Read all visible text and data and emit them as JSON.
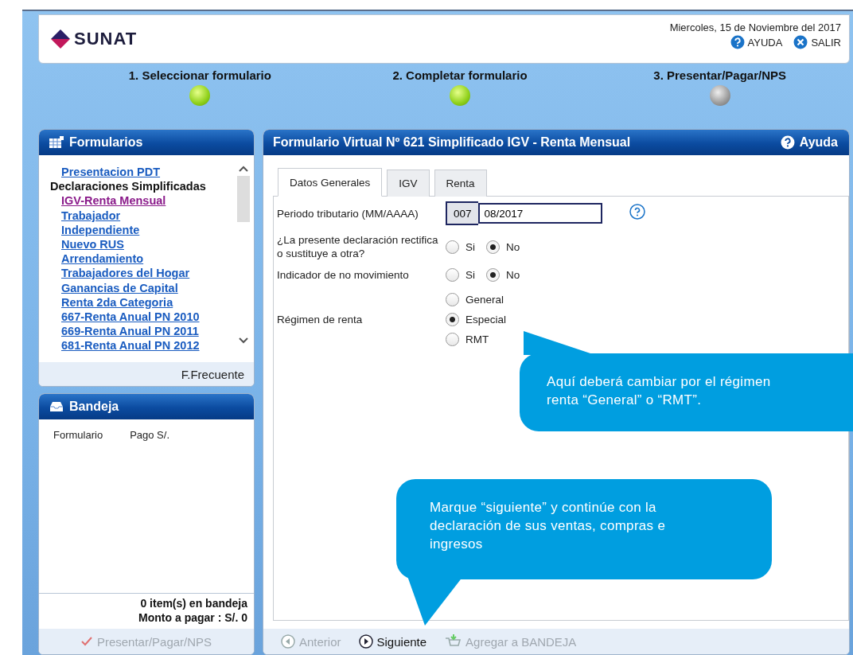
{
  "header": {
    "logo": "SUNAT",
    "date": "Miercoles, 15 de Noviembre del 2017",
    "links": [
      {
        "label": "AYUDA",
        "kind": "help"
      },
      {
        "label": "SALIR",
        "kind": "close"
      }
    ]
  },
  "steps": [
    {
      "label": "1. Seleccionar formulario",
      "done": true
    },
    {
      "label": "2. Completar formulario",
      "done": true
    },
    {
      "label": "3. Presentar/Pagar/NPS",
      "done": false
    }
  ],
  "formularios": {
    "title": "Formularios",
    "items": [
      {
        "label": "Presentacion PDT",
        "kind": "link",
        "visited": false
      },
      {
        "label": "Declaraciones Simplificadas",
        "kind": "heading"
      },
      {
        "label": "IGV-Renta Mensual",
        "kind": "link",
        "visited": true
      },
      {
        "label": "Trabajador",
        "kind": "link",
        "visited": false
      },
      {
        "label": "Independiente",
        "kind": "link",
        "visited": false
      },
      {
        "label": "Nuevo RUS",
        "kind": "link",
        "visited": false
      },
      {
        "label": "Arrendamiento",
        "kind": "link",
        "visited": false
      },
      {
        "label": "Trabajadores del Hogar",
        "kind": "link",
        "visited": false
      },
      {
        "label": "Ganancias de Capital",
        "kind": "link",
        "visited": false
      },
      {
        "label": "Renta 2da Categoria",
        "kind": "link",
        "visited": false
      },
      {
        "label": "667-Renta Anual PN 2010",
        "kind": "link",
        "visited": false
      },
      {
        "label": "669-Renta Anual PN 2011",
        "kind": "link",
        "visited": false
      },
      {
        "label": "681-Renta Anual PN 2012",
        "kind": "link",
        "visited": false
      }
    ],
    "footer": "F.Frecuente"
  },
  "bandeja": {
    "title": "Bandeja",
    "columns": [
      "Formulario",
      "Pago S/."
    ],
    "summary": [
      "0 item(s) en bandeja",
      "Monto a pagar : S/. 0"
    ],
    "button": {
      "label": "Presentar/Pagar/NPS",
      "disabled": true
    }
  },
  "form": {
    "title": "Formulario Virtual Nº 621 Simplificado IGV - Renta Mensual",
    "help": "Ayuda",
    "tabs": [
      {
        "label": "Datos Generales",
        "selected": true
      },
      {
        "label": "IGV",
        "selected": false
      },
      {
        "label": "Renta",
        "selected": false
      }
    ],
    "periodo": {
      "label": "Periodo tributario (MM/AAAA)",
      "code": "007",
      "value": "08/2017"
    },
    "groups": [
      {
        "label": "¿La presente declaración rectifica o sustituye a otra?",
        "kind": "row",
        "options": [
          {
            "label": "Si",
            "selected": false
          },
          {
            "label": "No",
            "selected": true
          }
        ]
      },
      {
        "label": "Indicador de no movimiento",
        "kind": "row",
        "options": [
          {
            "label": "Si",
            "selected": false
          },
          {
            "label": "No",
            "selected": true
          }
        ]
      },
      {
        "label": "Régimen de renta",
        "kind": "column",
        "options": [
          {
            "label": "General",
            "selected": false
          },
          {
            "label": "Especial",
            "selected": true
          },
          {
            "label": "RMT",
            "selected": false
          }
        ]
      }
    ],
    "toolbar": [
      {
        "label": "Anterior",
        "kind": "back",
        "disabled": true
      },
      {
        "label": "Siguiente",
        "kind": "next",
        "disabled": false
      },
      {
        "label": "Agregar a BANDEJA",
        "kind": "cart",
        "disabled": true
      }
    ]
  },
  "callouts": [
    {
      "lines": [
        "Aquí deberá cambiar por el régimen",
        "renta “General” o “RMT”."
      ],
      "kind": "up"
    },
    {
      "lines": [
        "Marque “siguiente” y continúe con la",
        "declaración de sus ventas, compras e",
        "ingresos"
      ],
      "kind": "down"
    }
  ]
}
